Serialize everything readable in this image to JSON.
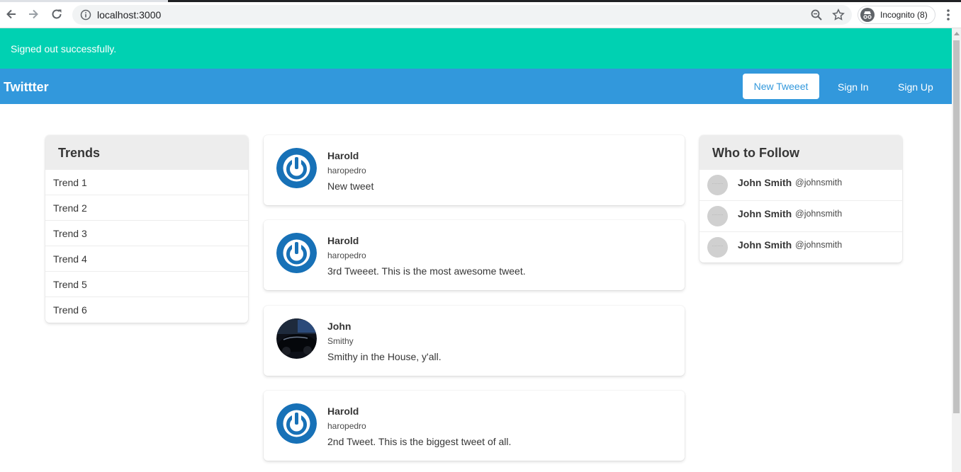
{
  "browser": {
    "url": "localhost:3000",
    "incognito_label": "Incognito (8)"
  },
  "notice": {
    "text": "Signed out successfully.",
    "color": "#00d1b2"
  },
  "navbar": {
    "brand": "Twittter",
    "new_tweet": "New Tweeet",
    "sign_in": "Sign In",
    "sign_up": "Sign Up",
    "color": "#3298dc"
  },
  "trends": {
    "title": "Trends",
    "items": [
      "Trend 1",
      "Trend 2",
      "Trend 3",
      "Trend 4",
      "Trend 5",
      "Trend 6"
    ]
  },
  "tweets": [
    {
      "name": "Harold",
      "handle": "haropedro",
      "body": "New tweet",
      "avatar": "power-icon"
    },
    {
      "name": "Harold",
      "handle": "haropedro",
      "body": "3rd Tweeet. This is the most awesome tweet.",
      "avatar": "power-icon"
    },
    {
      "name": "John",
      "handle": "Smithy",
      "body": "Smithy in the House, y'all.",
      "avatar": "car-photo"
    },
    {
      "name": "Harold",
      "handle": "haropedro",
      "body": "2nd Tweet. This is the biggest tweet of all.",
      "avatar": "power-icon"
    }
  ],
  "who_to_follow": {
    "title": "Who to Follow",
    "users": [
      {
        "name": "John Smith",
        "handle": "@johnsmith"
      },
      {
        "name": "John Smith",
        "handle": "@johnsmith"
      },
      {
        "name": "John Smith",
        "handle": "@johnsmith"
      }
    ]
  }
}
